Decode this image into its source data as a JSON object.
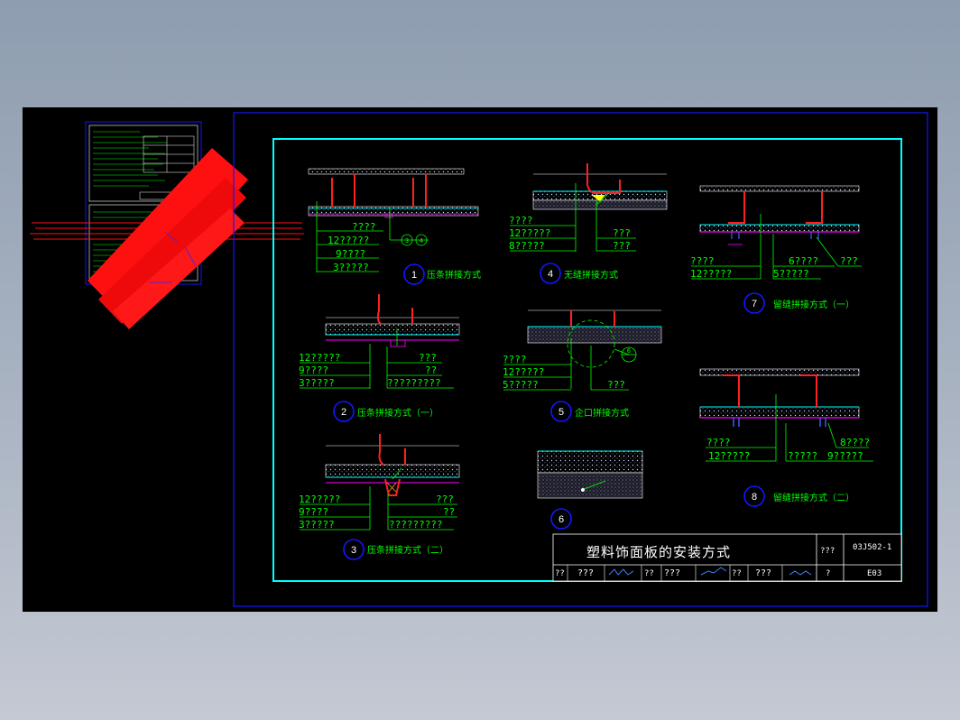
{
  "drawing": {
    "title": "塑料饰面板的安装方式",
    "code": "03J502-1",
    "page": "E03",
    "title_block_labels": [
      "??",
      "???",
      "??",
      "???",
      "??",
      "???",
      "???",
      "?"
    ],
    "details": [
      {
        "num": "1",
        "caption": "压条拼接方式",
        "notes": [
          "????",
          "12?????",
          "9????",
          "3?????"
        ]
      },
      {
        "num": "2",
        "caption": "压条拼接方式（一）",
        "notes": [
          "12?????",
          "9????",
          "3?????",
          "???",
          "??",
          "?????????"
        ]
      },
      {
        "num": "3",
        "caption": "压条拼接方式（二）",
        "notes": [
          "12?????",
          "9????",
          "3?????",
          "???",
          "??",
          "?????????"
        ]
      },
      {
        "num": "4",
        "caption": "无缝拼接方式",
        "notes": [
          "????",
          "12?????",
          "8?????",
          "???",
          "???"
        ]
      },
      {
        "num": "5",
        "caption": "企口拼接方式",
        "notes": [
          "????",
          "12?????",
          "5?????",
          "???"
        ]
      },
      {
        "num": "6",
        "caption": "",
        "notes": []
      },
      {
        "num": "7",
        "caption": "留缝拼接方式（一）",
        "notes": [
          "????",
          "12?????",
          "6????",
          "5?????",
          "???"
        ]
      },
      {
        "num": "8",
        "caption": "留缝拼接方式（二）",
        "notes": [
          "????",
          "12?????",
          "?????",
          "8????",
          "9?????"
        ]
      }
    ],
    "callout_labels": [
      "3",
      "4",
      "6"
    ]
  },
  "colors": {
    "background": "#000000",
    "frame_blue": "#1515ff",
    "sheet_border": "#00ffff",
    "annotation_green": "#00ff00",
    "section_red": "#ff0000",
    "markup_red": "#ff1010",
    "text_white": "#ffffff"
  }
}
